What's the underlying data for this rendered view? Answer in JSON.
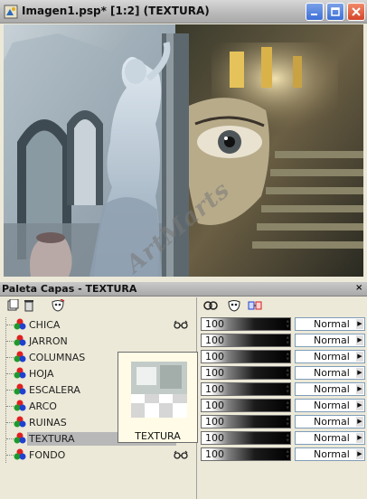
{
  "window": {
    "title": "Imagen1.psp* [1:2] (TEXTURA)",
    "buttons": {
      "minimize": "minimize",
      "maximize": "maximize",
      "close": "close"
    }
  },
  "watermark": "ArtMarts",
  "palette": {
    "title": "Paleta Capas - TEXTURA",
    "toolbar_icons": [
      "new-layer-icon",
      "delete-layer-icon",
      "mask-icon"
    ],
    "right_tab_icons": [
      "link-icon",
      "mask-tab-icon",
      "group-icon"
    ],
    "layers": [
      {
        "name": "CHICA",
        "selected": false,
        "visible": true,
        "opacity": "100",
        "blend": "Normal"
      },
      {
        "name": "JARRON",
        "selected": false,
        "visible": false,
        "opacity": "100",
        "blend": "Normal"
      },
      {
        "name": "COLUMNAS",
        "selected": false,
        "visible": false,
        "opacity": "100",
        "blend": "Normal"
      },
      {
        "name": "HOJA",
        "selected": false,
        "visible": false,
        "opacity": "100",
        "blend": "Normal"
      },
      {
        "name": "ESCALERA",
        "selected": false,
        "visible": false,
        "opacity": "100",
        "blend": "Normal"
      },
      {
        "name": "ARCO",
        "selected": false,
        "visible": false,
        "opacity": "100",
        "blend": "Normal"
      },
      {
        "name": "RUINAS",
        "selected": false,
        "visible": false,
        "opacity": "100",
        "blend": "Normal"
      },
      {
        "name": "TEXTURA",
        "selected": true,
        "visible": true,
        "opacity": "100",
        "blend": "Normal"
      },
      {
        "name": "FONDO",
        "selected": false,
        "visible": true,
        "opacity": "100",
        "blend": "Normal"
      }
    ],
    "thumbnail_label": "TEXTURA"
  }
}
